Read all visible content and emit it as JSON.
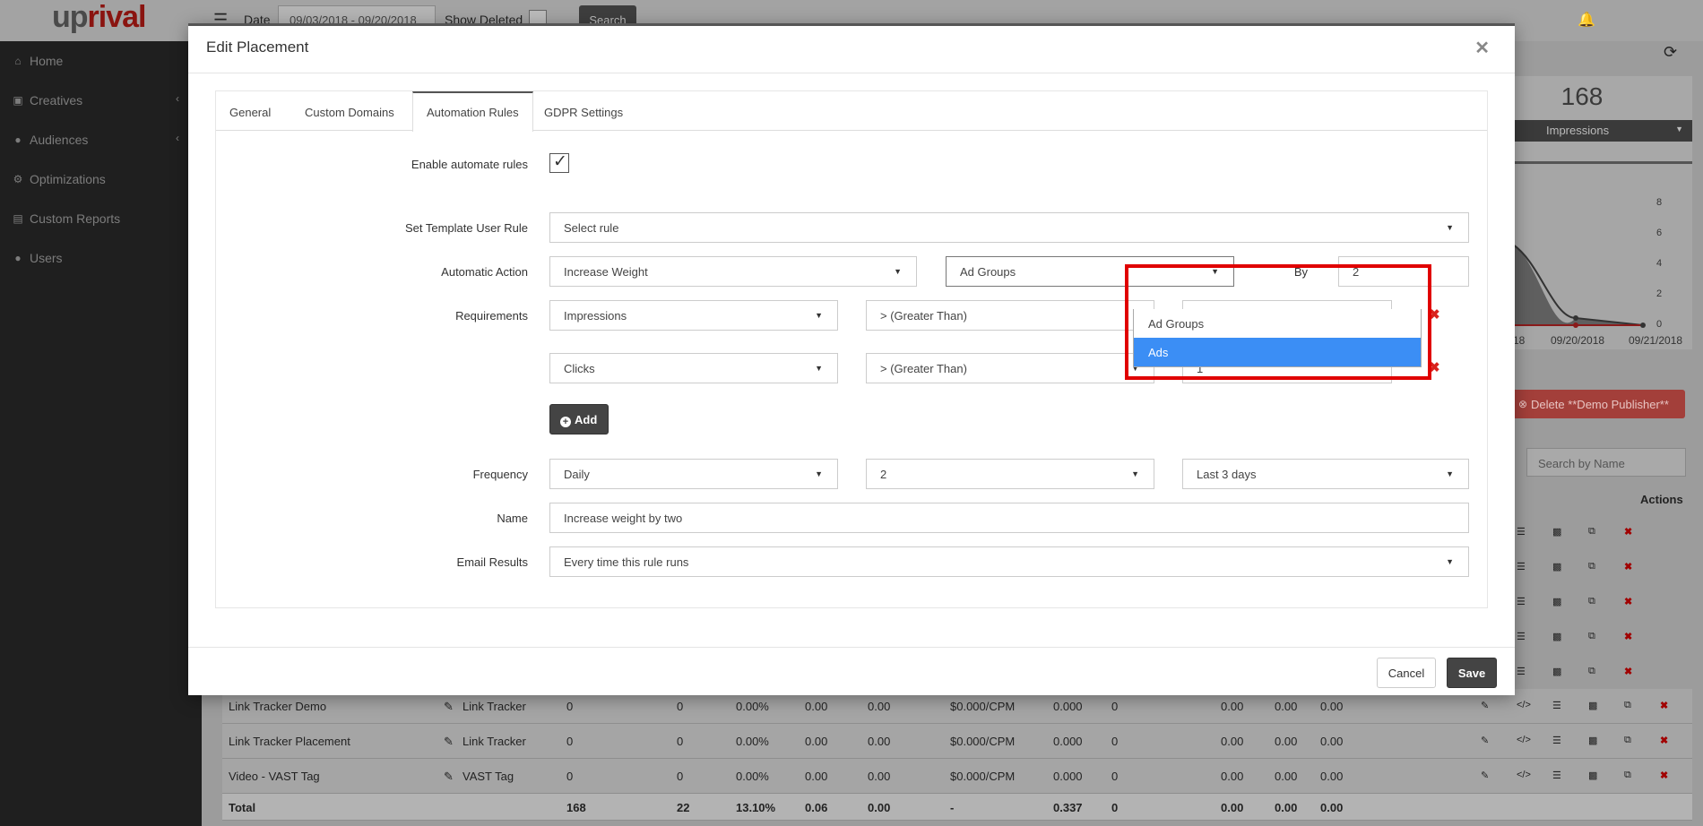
{
  "app": {
    "logo_up": "up",
    "logo_rival": "rival"
  },
  "topbar": {
    "date_label": "Date",
    "date_range": "09/03/2018 - 09/20/2018",
    "show_deleted_label": "Show Deleted",
    "search_label": "Search"
  },
  "sidebar": {
    "items": [
      {
        "label": "Home",
        "icon": "home-icon"
      },
      {
        "label": "Creatives",
        "icon": "image-icon"
      },
      {
        "label": "Audiences",
        "icon": "users-icon"
      },
      {
        "label": "Optimizations",
        "icon": "gears-icon"
      },
      {
        "label": "Custom Reports",
        "icon": "file-icon"
      },
      {
        "label": "Users",
        "icon": "user-icon"
      }
    ]
  },
  "background": {
    "kpi_value": "168",
    "kpi_metric": "Impressions",
    "chart_ticks_y": [
      "8",
      "6",
      "4",
      "2",
      "0"
    ],
    "chart_ticks_x": [
      "18",
      "09/20/2018",
      "09/21/2018"
    ],
    "delete_button": "Delete **Demo Publisher**",
    "search_placeholder": "Search by Name",
    "actions_header": "Actions",
    "rows": [
      {
        "name": "Link Tracker Demo",
        "type": "Link Tracker",
        "c1": "0",
        "c2": "0",
        "c3": "0.00%",
        "c4": "0.00",
        "c5": "0.00",
        "c6": "$0.000/CPM",
        "c7": "0.000",
        "c8": "0",
        "c9": "0.00",
        "c10": "0.00",
        "c11": "0.00"
      },
      {
        "name": "Link Tracker Placement",
        "type": "Link Tracker",
        "c1": "0",
        "c2": "0",
        "c3": "0.00%",
        "c4": "0.00",
        "c5": "0.00",
        "c6": "$0.000/CPM",
        "c7": "0.000",
        "c8": "0",
        "c9": "0.00",
        "c10": "0.00",
        "c11": "0.00"
      },
      {
        "name": "Video - VAST Tag",
        "type": "VAST Tag",
        "c1": "0",
        "c2": "0",
        "c3": "0.00%",
        "c4": "0.00",
        "c5": "0.00",
        "c6": "$0.000/CPM",
        "c7": "0.000",
        "c8": "0",
        "c9": "0.00",
        "c10": "0.00",
        "c11": "0.00"
      }
    ],
    "total": {
      "name": "Total",
      "c1": "168",
      "c2": "22",
      "c3": "13.10%",
      "c4": "0.06",
      "c5": "0.00",
      "c6": "-",
      "c7": "0.337",
      "c8": "0",
      "c9": "0.00",
      "c10": "0.00",
      "c11": "0.00"
    }
  },
  "modal": {
    "title": "Edit Placement",
    "tabs": [
      "General",
      "Custom Domains",
      "Automation Rules",
      "GDPR Settings"
    ],
    "active_tab": "Automation Rules",
    "labels": {
      "enable": "Enable automate rules",
      "template": "Set Template User Rule",
      "action": "Automatic Action",
      "requirements": "Requirements",
      "by": "By",
      "frequency": "Frequency",
      "name": "Name",
      "email": "Email Results"
    },
    "enable_checked": true,
    "template_value": "Select rule",
    "action_value": "Increase Weight",
    "target_value": "Ad Groups",
    "target_options": [
      "Ad Groups",
      "Ads"
    ],
    "target_highlighted": "Ads",
    "by_value": "2",
    "requirements": [
      {
        "metric": "Impressions",
        "operator": "> (Greater Than)",
        "value": ""
      },
      {
        "metric": "Clicks",
        "operator": "> (Greater Than)",
        "value": "1"
      }
    ],
    "add_label": "Add",
    "frequency": {
      "period": "Daily",
      "count": "2",
      "window": "Last 3 days"
    },
    "name_value": "Increase weight by two",
    "email_value": "Every time this rule runs",
    "cancel_label": "Cancel",
    "save_label": "Save"
  },
  "colors": {
    "accent_blue": "#3b8ef5",
    "danger_red": "#d9231d",
    "highlight_red": "#e00000",
    "dark_button": "#444444",
    "brand_red": "#8a1410"
  }
}
